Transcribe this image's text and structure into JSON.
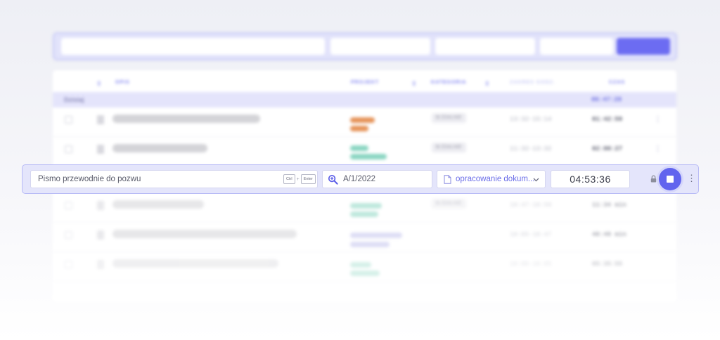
{
  "table": {
    "headers": {
      "desc": "OPIS",
      "project": "PROJEKT",
      "category": "KATEGORIA",
      "range": "ZAKRES GODZ.",
      "time": "CZAS"
    },
    "group": {
      "label": "Dzisiaj",
      "sum": "06:47:28"
    },
    "rows": [
      {
        "category": "ZDALNIE",
        "range": "13:32-15:14",
        "time": "01:42:59"
      },
      {
        "category": "ZDALNIE",
        "range": "11:32-13:32",
        "time": "02:00:27"
      },
      {
        "category": "ZDALNIE",
        "range": "10:47-10:59",
        "time": "11:34 min"
      },
      {
        "category": "",
        "range": "10:05-10:47",
        "time": "40:49 min"
      },
      {
        "category": "",
        "range": "10:00-10:05",
        "time": "05:35:55"
      }
    ]
  },
  "timer": {
    "description": "Pismo przewodnie do pozwu",
    "shortcut_key1": "Ctrl",
    "shortcut_plus": "+",
    "shortcut_key2": "Enter",
    "project": "A/1/2022",
    "category": "opracowanie dokum...",
    "elapsed": "04:53:36"
  },
  "colors": {
    "accent": "#6164ee",
    "tag_orange": "#e6945a",
    "tag_green": "#8bd6c2",
    "tag_purple": "#c4c4ee"
  },
  "icons": {
    "project": "search-plus-icon",
    "category": "document-icon",
    "dropdown": "chevron-down-icon",
    "lock": "lock-icon",
    "stop": "stop-icon",
    "more": "vertical-dots-icon"
  }
}
